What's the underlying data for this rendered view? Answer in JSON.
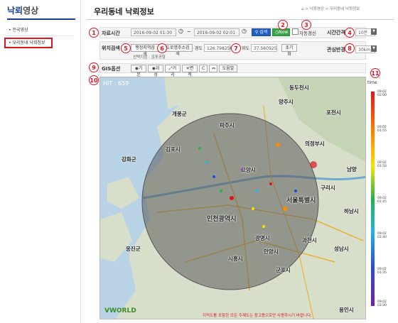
{
  "sidebar": {
    "title_prefix": "낙뢰",
    "title_suffix": "영상",
    "items": [
      {
        "label": "전국영상"
      },
      {
        "label": "우리동네 낙뢰정보"
      }
    ]
  },
  "header": {
    "title": "우리동네 낙뢰정보",
    "breadcrumb": "낙뢰영상 > 우리동네 낙뢰정보"
  },
  "controls": {
    "data_time_label": "자료시간",
    "start_time": "2016-09-02 01:30",
    "tilde": "~",
    "end_time": "2016-09-02 02:01",
    "search_button": "검색",
    "now_button": "Now",
    "auto_refresh_label": "자동갱신",
    "time_interval_label": "시간간격",
    "time_interval_value": "10분",
    "location_search_label": "위치검색",
    "admin_search_button": "행정지역검색",
    "address_search_button": "도로명주소검색",
    "longitude_label": "경도",
    "longitude_value": "126.798256",
    "latitude_label": "위도",
    "latitude_value": "37.560925",
    "reset_button": "초기화",
    "selected_area_label": "선택지점 : 김포공항",
    "interest_radius_label": "관심반경",
    "interest_radius_value": "30km",
    "gis_label": "GIS옵션",
    "gis_buttons": [
      "기본",
      "위성",
      "거리",
      "면적",
      "C",
      "⇔",
      "도움말"
    ]
  },
  "callouts": [
    "1",
    "2",
    "3",
    "4",
    "5",
    "6",
    "7",
    "8",
    "9",
    "10",
    "11"
  ],
  "map": {
    "overlay_text": "HIT : 659",
    "brand": "VWORLD",
    "places": [
      {
        "name": "동두천시"
      },
      {
        "name": "양주시"
      },
      {
        "name": "개풍군"
      },
      {
        "name": "포천시"
      },
      {
        "name": "파주시"
      },
      {
        "name": "의정부시"
      },
      {
        "name": "김포시"
      },
      {
        "name": "고양시"
      },
      {
        "name": "남양"
      },
      {
        "name": "구리시"
      },
      {
        "name": "인천광역시"
      },
      {
        "name": "서울특별시"
      },
      {
        "name": "하남시"
      },
      {
        "name": "광명시"
      },
      {
        "name": "과천시"
      },
      {
        "name": "성남시"
      },
      {
        "name": "시흥시"
      },
      {
        "name": "안양시"
      },
      {
        "name": "군포시"
      },
      {
        "name": "용인시"
      },
      {
        "name": "강화군"
      },
      {
        "name": "옹진군"
      }
    ]
  },
  "legend": {
    "title": "time",
    "labels": [
      "09.02 02:00",
      "09.02 01:55",
      "09.02 01:50",
      "09.02 01:45",
      "09.02 01:40",
      "09.02 01:35",
      "09.02 01:30"
    ],
    "colors": [
      "#e0141e",
      "#ff8a00",
      "#f2e600",
      "#23b14d",
      "#27b5e0",
      "#2a4bd3",
      "#7a1ea0"
    ]
  },
  "footer": {
    "note": "지적도를 포함한 모든 주제도는 참고용으로만 사용하시기 바랍니다."
  }
}
